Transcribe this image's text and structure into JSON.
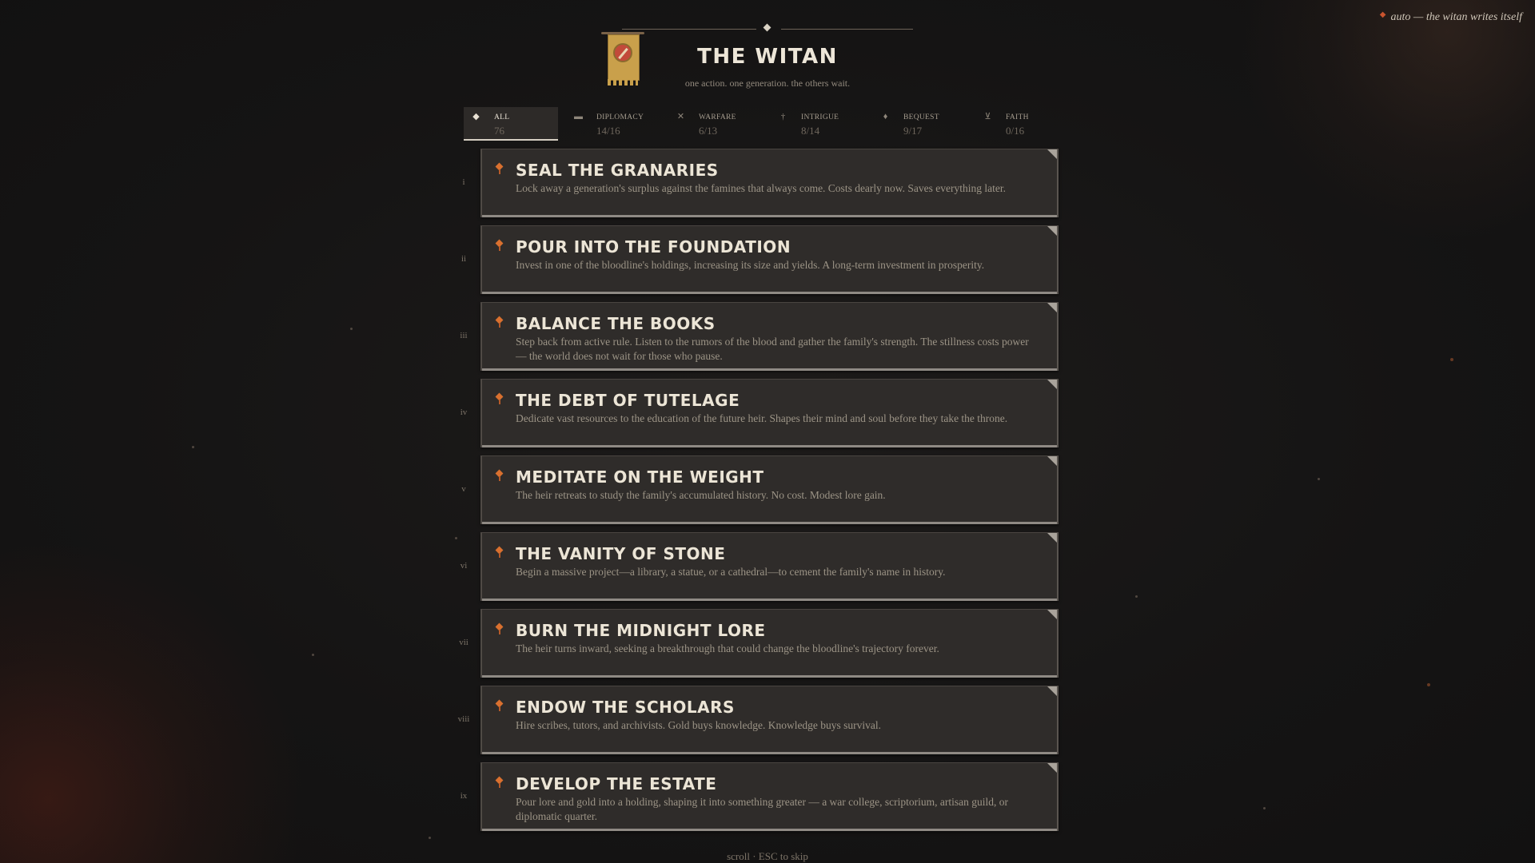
{
  "header": {
    "title": "THE WITAN",
    "subtitle": "one action. one generation. the others wait.",
    "banner_icon": "sigil-banner-icon"
  },
  "auto_toggle": {
    "label": "auto — the witan writes itself",
    "indicator_color": "#c8532e"
  },
  "tabs": [
    {
      "label": "ALL",
      "count": "76",
      "icon": "diamond-icon",
      "active": true
    },
    {
      "label": "DIPLOMACY",
      "count": "14/16",
      "icon": "scroll-icon"
    },
    {
      "label": "WARFARE",
      "count": "6/13",
      "icon": "crossed-swords-icon"
    },
    {
      "label": "INTRIGUE",
      "count": "8/14",
      "icon": "dagger-icon"
    },
    {
      "label": "BEQUEST",
      "count": "9/17",
      "icon": "flame-icon"
    },
    {
      "label": "FAITH",
      "count": "0/16",
      "icon": "chalice-icon"
    }
  ],
  "actions": [
    {
      "numeral": "i",
      "title": "SEAL THE GRANARIES",
      "description": "Lock away a generation's surplus against the famines that always come. Costs dearly now. Saves everything later."
    },
    {
      "numeral": "ii",
      "title": "POUR INTO THE FOUNDATION",
      "description": "Invest in one of the bloodline's holdings, increasing its size and yields. A long-term investment in prosperity."
    },
    {
      "numeral": "iii",
      "title": "BALANCE THE BOOKS",
      "description": "Step back from active rule. Listen to the rumors of the blood and gather the family's strength. The stillness costs power — the world does not wait for those who pause."
    },
    {
      "numeral": "iv",
      "title": "THE DEBT OF TUTELAGE",
      "description": "Dedicate vast resources to the education of the future heir. Shapes their mind and soul before they take the throne."
    },
    {
      "numeral": "v",
      "title": "MEDITATE ON THE WEIGHT",
      "description": "The heir retreats to study the family's accumulated history. No cost. Modest lore gain."
    },
    {
      "numeral": "vi",
      "title": "THE VANITY OF STONE",
      "description": "Begin a massive project—a library, a statue, or a cathedral—to cement the family's name in history."
    },
    {
      "numeral": "vii",
      "title": "BURN THE MIDNIGHT LORE",
      "description": "The heir turns inward, seeking a breakthrough that could change the bloodline's trajectory forever."
    },
    {
      "numeral": "viii",
      "title": "ENDOW THE SCHOLARS",
      "description": "Hire scribes, tutors, and archivists. Gold buys knowledge. Knowledge buys survival."
    },
    {
      "numeral": "ix",
      "title": "DEVELOP THE ESTATE",
      "description": "Pour lore and gold into a holding, shaping it into something greater — a war college, scriptorium, artisan guild, or diplomatic quarter."
    }
  ],
  "footer": {
    "hint": "scroll · ESC to skip"
  },
  "colors": {
    "accent": "#d9702f",
    "card_bg": "#2f2c2a",
    "page_bg": "#141313"
  }
}
